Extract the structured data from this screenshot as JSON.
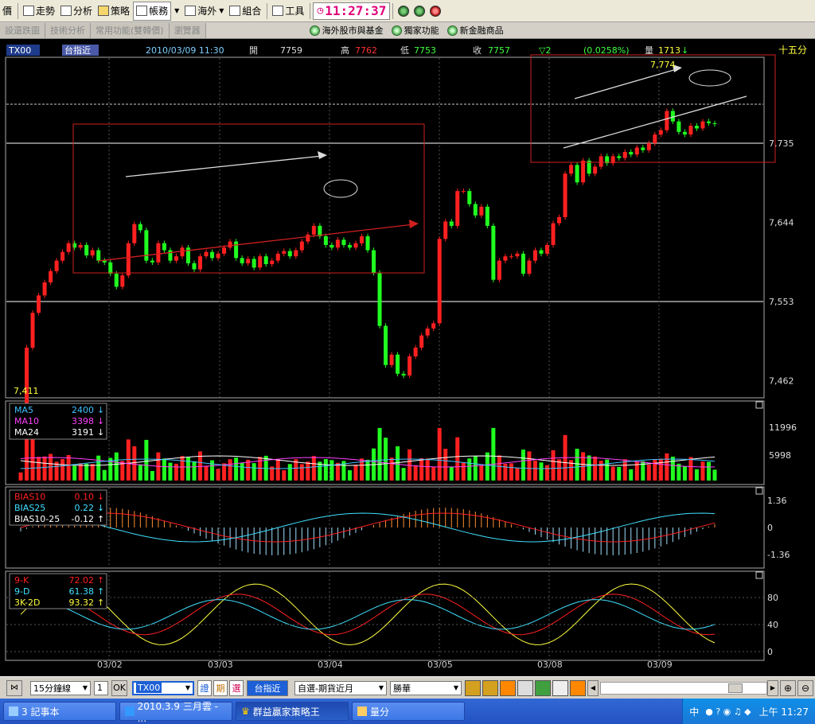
{
  "toolbar": {
    "items": [
      "價",
      "走勢",
      "分析",
      "策略",
      "帳務",
      "海外",
      "組合",
      "工具"
    ],
    "clock": "11:27:37"
  },
  "tabs": [
    "設還跌圖",
    "技術分析",
    "常用功能(雙韓價)",
    "瀏覽器"
  ],
  "links": [
    "海外股市與基金",
    "獨家功能",
    "新金融商品"
  ],
  "header": {
    "code": "TX00",
    "name": "台指近",
    "datetime": "2010/03/09 11:30",
    "open_label": "開",
    "open": "7759",
    "high_label": "高",
    "high": "7762",
    "low_label": "低",
    "low": "7753",
    "close_label": "收",
    "close": "7757",
    "change": "▽2",
    "change_pct": "(0.0258%)",
    "vol_label": "量",
    "vol": "1713",
    "vol_arrow": "↓",
    "period": "十五分"
  },
  "price_axis": [
    "7,735",
    "7,644",
    "7,553",
    "7,462"
  ],
  "price_annotations": {
    "high_label": "7,774",
    "low_label": "7,411"
  },
  "date_labels": [
    "03/02",
    "03/03",
    "03/04",
    "03/05",
    "03/08",
    "03/09"
  ],
  "volume_legend": [
    {
      "name": "MA5",
      "value": "2400",
      "arrow": "↓",
      "color": "#40c0ff"
    },
    {
      "name": "MA10",
      "value": "3398",
      "arrow": "↓",
      "color": "#ff40ff"
    },
    {
      "name": "MA24",
      "value": "3191",
      "arrow": "↓",
      "color": "#ffffff"
    }
  ],
  "volume_axis": [
    "11996",
    "5998"
  ],
  "bias_legend": [
    {
      "name": "BIAS10",
      "value": "0.10",
      "arrow": "↓",
      "color": "#ff2020"
    },
    {
      "name": "BIAS25",
      "value": "0.22",
      "arrow": "↓",
      "color": "#40e0ff"
    },
    {
      "name": "BIAS10-25",
      "value": "-0.12",
      "arrow": "↑",
      "color": "#ffffff"
    }
  ],
  "bias_axis": [
    "1.36",
    "0",
    "-1.36"
  ],
  "kd_legend": [
    {
      "name": "9-K",
      "value": "72.02",
      "arrow": "↑",
      "color": "#ff2020"
    },
    {
      "name": "9-D",
      "value": "61.38",
      "arrow": "↑",
      "color": "#40e0ff"
    },
    {
      "name": "3K-2D",
      "value": "93.32",
      "arrow": "↑",
      "color": "#ffff40"
    }
  ],
  "kd_axis": [
    "80",
    "40",
    "0"
  ],
  "bottombar": {
    "period_select": "15分鐘線",
    "count": "1",
    "ok": "OK",
    "code_input": "TX00",
    "btn1": "證",
    "btn2": "期",
    "btn3": "選",
    "name_button": "台指近",
    "group_select": "自選-期貨近月",
    "broker_select": "勝華"
  },
  "taskbar": {
    "tasks": [
      "3 記事本",
      "2010.3.9 三月雲 - ...",
      "群益贏家策略王",
      "量分"
    ],
    "tray_time": "上午 11:27",
    "tray_lang": "中"
  }
}
